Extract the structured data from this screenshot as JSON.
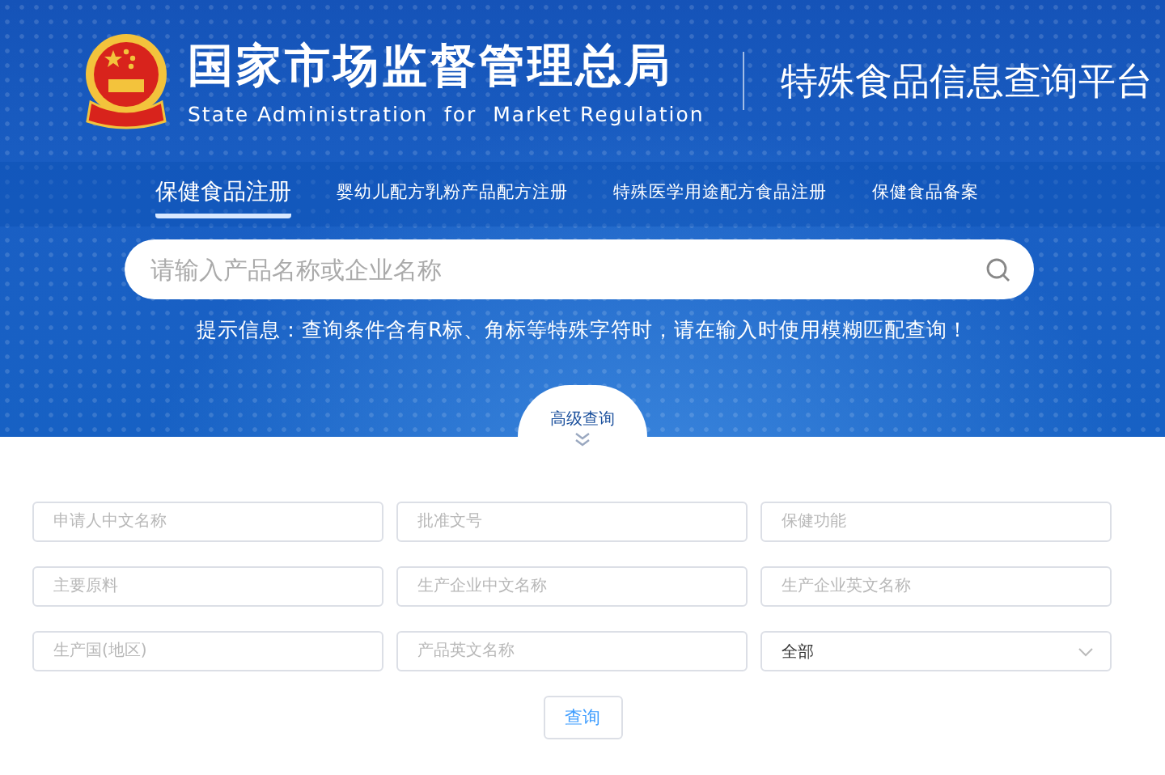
{
  "header": {
    "title": "国家市场监督管理总局",
    "subtitle": "State Administration  for  Market Regulation",
    "platform": "特殊食品信息查询平台"
  },
  "tabs": [
    {
      "label": "保健食品注册",
      "selected": true
    },
    {
      "label": "婴幼儿配方乳粉产品配方注册",
      "selected": false
    },
    {
      "label": "特殊医学用途配方食品注册",
      "selected": false
    },
    {
      "label": "保健食品备案",
      "selected": false
    }
  ],
  "search": {
    "placeholder": "请输入产品名称或企业名称"
  },
  "hint": "提示信息：查询条件含有R标、角标等特殊字符时，请在输入时使用模糊匹配查询！",
  "advanced_toggle": "高级查询",
  "fields": [
    {
      "kind": "input",
      "placeholder": "申请人中文名称"
    },
    {
      "kind": "input",
      "placeholder": "批准文号"
    },
    {
      "kind": "input",
      "placeholder": "保健功能"
    },
    {
      "kind": "input",
      "placeholder": "主要原料"
    },
    {
      "kind": "input",
      "placeholder": "生产企业中文名称"
    },
    {
      "kind": "input",
      "placeholder": "生产企业英文名称"
    },
    {
      "kind": "input",
      "placeholder": "生产国(地区)"
    },
    {
      "kind": "input",
      "placeholder": "产品英文名称"
    },
    {
      "kind": "select",
      "value": "全部"
    }
  ],
  "query_button": "查询"
}
